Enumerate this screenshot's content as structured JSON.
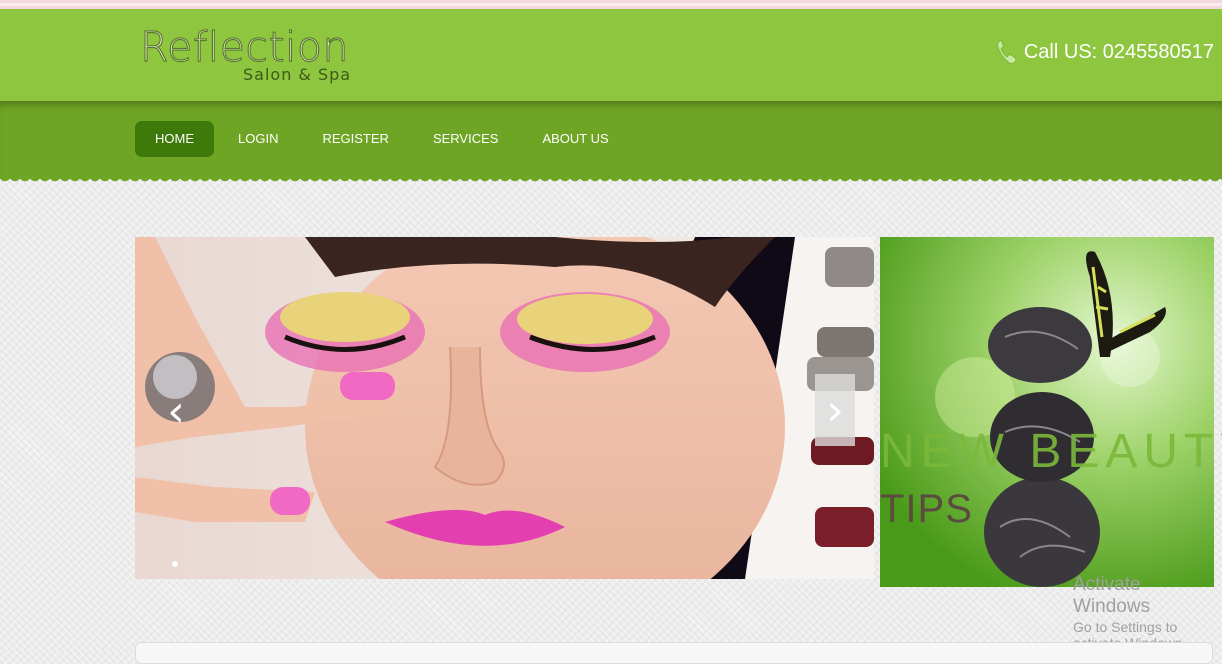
{
  "brand": {
    "name": "Reflection",
    "tagline": "Salon & Spa"
  },
  "header": {
    "call_label": "Call US: 0245580517",
    "phone_icon": "phone-icon"
  },
  "nav": {
    "items": [
      {
        "label": "HOME",
        "active": true
      },
      {
        "label": "LOGIN",
        "active": false
      },
      {
        "label": "REGISTER",
        "active": false
      },
      {
        "label": "SERVICES",
        "active": false
      },
      {
        "label": "ABOUT US",
        "active": false
      }
    ]
  },
  "slider": {
    "prev_icon": "chevron-left-icon",
    "next_icon": "chevron-right-icon"
  },
  "side_banner": {
    "line1": "NEW BEAUTY",
    "line2": "TIPS"
  },
  "windows_watermark": {
    "title": "Activate Windows",
    "subtitle": "Go to Settings to activate Windows."
  },
  "colors": {
    "header_green": "#8ec63f",
    "nav_green": "#6fa524",
    "active_nav": "#3d7a0a"
  }
}
